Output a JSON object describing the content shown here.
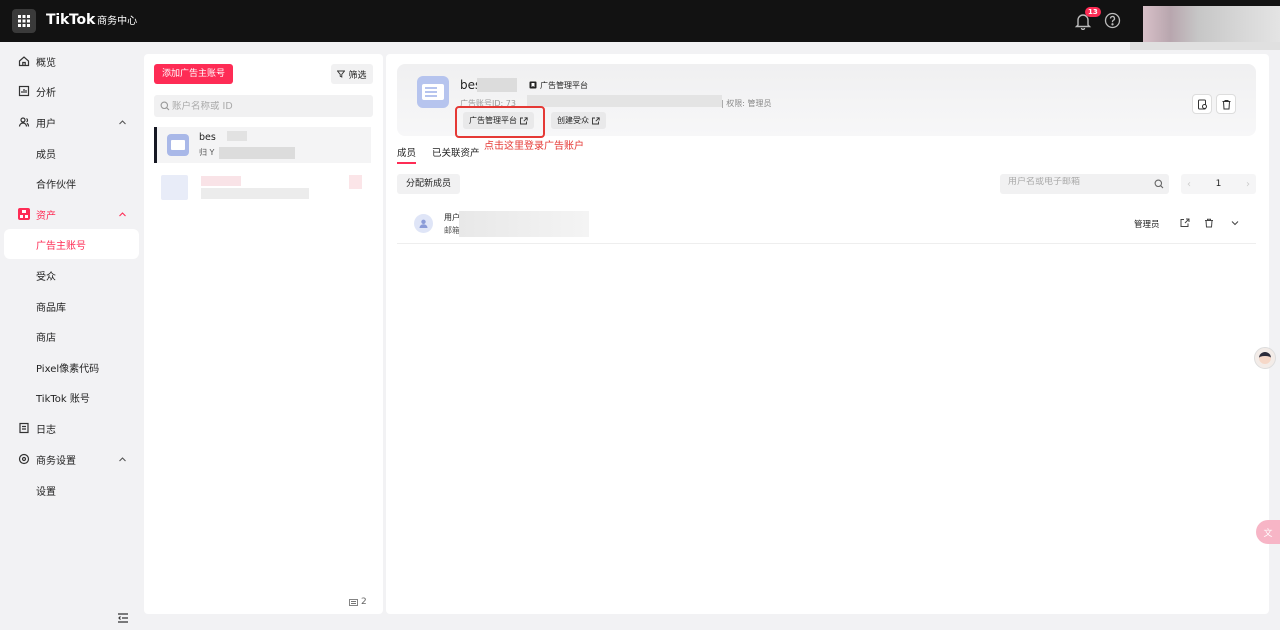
{
  "topbar": {
    "brand": "TikTok",
    "brand_sub": "商务中心",
    "notification_count": "13"
  },
  "sidebar": {
    "items": [
      {
        "label": "概览"
      },
      {
        "label": "分析"
      },
      {
        "label": "用户"
      },
      {
        "label": "成员"
      },
      {
        "label": "合作伙伴"
      },
      {
        "label": "资产"
      },
      {
        "label": "广告主账号"
      },
      {
        "label": "受众"
      },
      {
        "label": "商品库"
      },
      {
        "label": "商店"
      },
      {
        "label": "Pixel像素代码"
      },
      {
        "label": "TikTok 账号"
      },
      {
        "label": "日志"
      },
      {
        "label": "商务设置"
      },
      {
        "label": "设置"
      }
    ]
  },
  "accounts_panel": {
    "add_button": "添加广告主账号",
    "filter_button": "筛选",
    "search_placeholder": "账户名称或 ID",
    "selected_account": {
      "name": "bes",
      "sub": "归 Y"
    },
    "count": "2"
  },
  "detail": {
    "account_name": "bes",
    "platform_tag": "广告管理平台",
    "account_id_label": "广告账号ID: 73",
    "permission_label": "| 权限:",
    "permission_value": "管理员",
    "btn_ads_manager": "广告管理平台",
    "btn_create_audience": "创建受众",
    "annotation": "点击这里登录广告账户",
    "tabs": [
      {
        "label": "成员"
      },
      {
        "label": "已关联资产"
      }
    ],
    "assign_button": "分配新成员",
    "member_search_placeholder": "用户名或电子邮箱",
    "page": "1",
    "member": {
      "user_label": "用户",
      "email_label": "邮箱",
      "role": "管理员"
    }
  },
  "colors": {
    "accent": "#fe2c55",
    "topbar": "#121212",
    "annotation_red": "#e53935"
  }
}
